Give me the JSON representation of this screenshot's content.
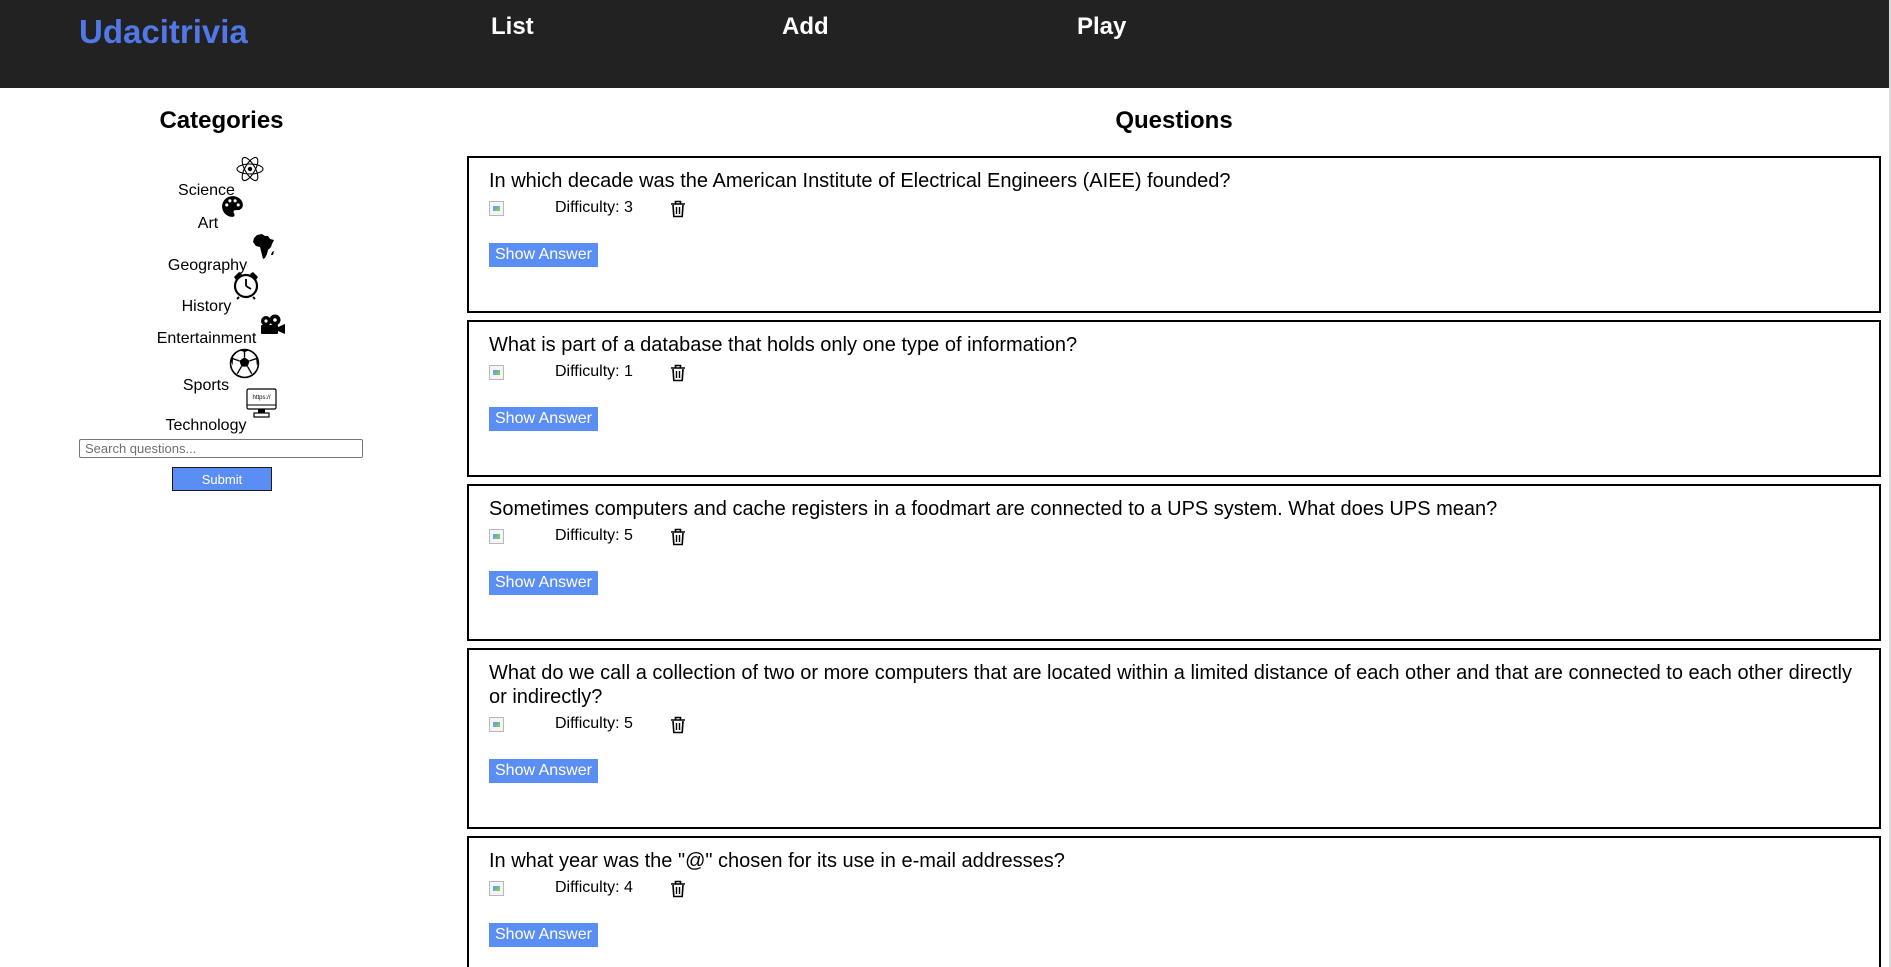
{
  "header": {
    "brand": "Udacitrivia",
    "nav": [
      {
        "label": "List"
      },
      {
        "label": "Add"
      },
      {
        "label": "Play"
      }
    ]
  },
  "categories": {
    "title": "Categories",
    "items": [
      {
        "label": "Science",
        "icon": "atom-icon"
      },
      {
        "label": "Art",
        "icon": "palette-icon"
      },
      {
        "label": "Geography",
        "icon": "africa-map-icon"
      },
      {
        "label": "History",
        "icon": "alarm-clock-icon"
      },
      {
        "label": "Entertainment",
        "icon": "film-camera-icon"
      },
      {
        "label": "Sports",
        "icon": "soccer-ball-icon"
      },
      {
        "label": "Technology",
        "icon": "computer-monitor-icon",
        "icon_text": "https://"
      }
    ]
  },
  "search": {
    "placeholder": "Search questions...",
    "submit_label": "Submit"
  },
  "questions": {
    "title": "Questions",
    "items": [
      {
        "question": "In which decade was the American Institute of Electrical Engineers (AIEE) founded?",
        "difficulty_text": "Difficulty: 3",
        "show_answer_label": "Show Answer"
      },
      {
        "question": "What is part of a database that holds only one type of information?",
        "difficulty_text": "Difficulty: 1",
        "show_answer_label": "Show Answer"
      },
      {
        "question": "Sometimes computers and cache registers in a foodmart are connected to a UPS system. What does UPS mean?",
        "difficulty_text": "Difficulty: 5",
        "show_answer_label": "Show Answer"
      },
      {
        "question": "What do we call a collection of two or more computers that are located within a limited distance of each other and that are connected to each other directly or indirectly?",
        "difficulty_text": "Difficulty: 5",
        "show_answer_label": "Show Answer"
      },
      {
        "question": "In what year was the \"@\" chosen for its use in e-mail addresses?",
        "difficulty_text": "Difficulty: 4",
        "show_answer_label": "Show Answer"
      }
    ]
  },
  "colors": {
    "header_bg": "#222222",
    "brand": "#5078e6",
    "button_bg": "#5b8ef5"
  }
}
